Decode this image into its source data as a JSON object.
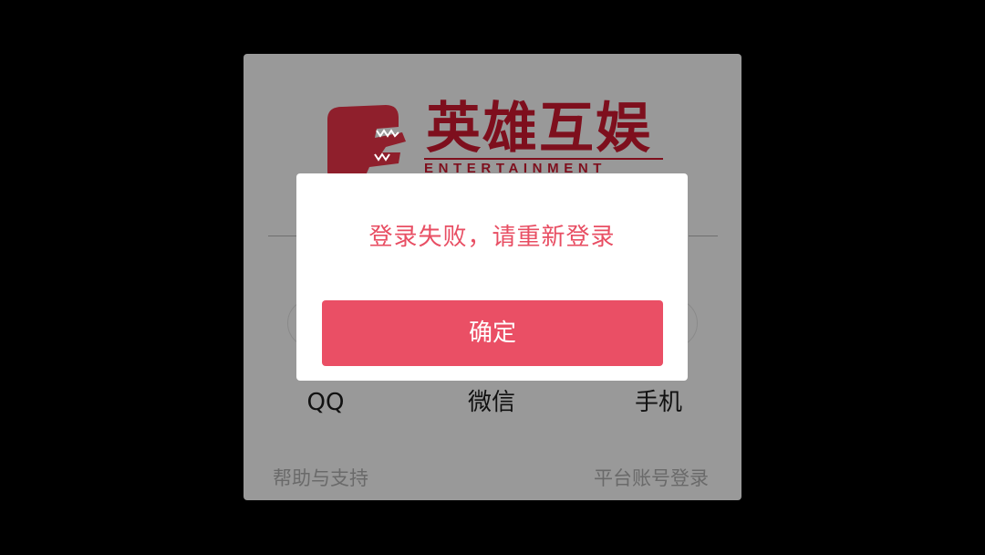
{
  "brand": {
    "name": "英雄互娱",
    "subtitle": "ENTERTAINMENT",
    "color": "#7e0f1d"
  },
  "login": {
    "options": [
      {
        "label": "QQ",
        "icon": "qq-icon"
      },
      {
        "label": "微信",
        "icon": "wechat-icon"
      },
      {
        "label": "手机",
        "icon": "phone-icon"
      }
    ],
    "help_link": "帮助与支持",
    "platform_login_link": "平台账号登录"
  },
  "dialog": {
    "message": "登录失败，请重新登录",
    "confirm_label": "确定",
    "accent_color": "#ea4f65"
  }
}
